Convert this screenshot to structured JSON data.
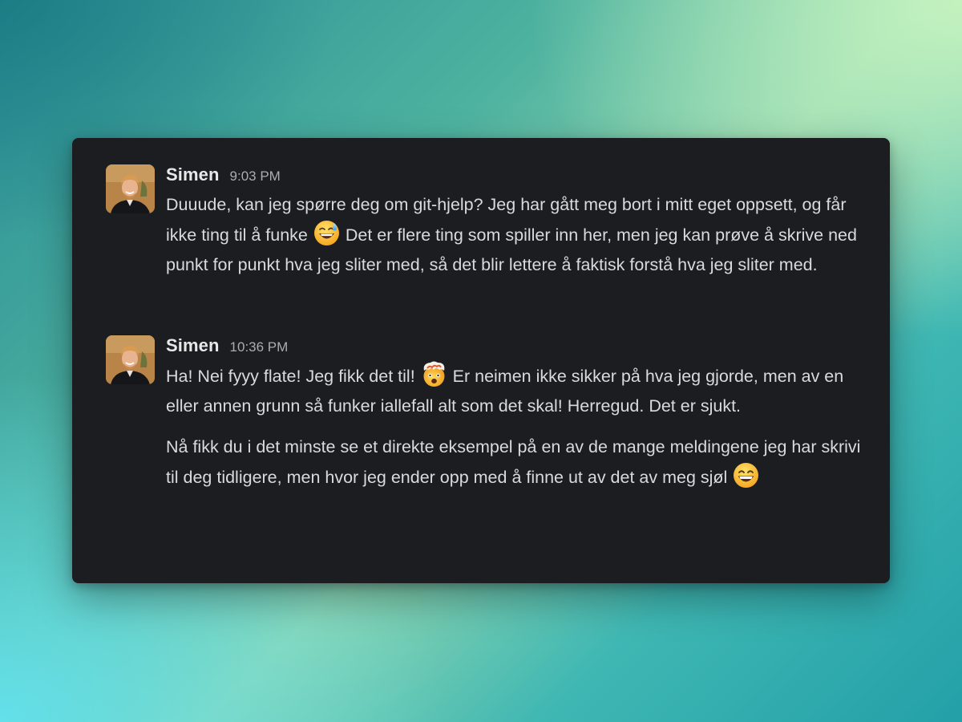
{
  "messages": [
    {
      "author": "Simen",
      "time": "9:03 PM",
      "paragraphs": [
        {
          "before": "Duuude, kan jeg spørre deg om git-hjelp? Jeg har gått meg bort i mitt eget oppsett, og får ikke ting til å funke",
          "emoji": "grinning-sweat-emoji",
          "after": "Det er flere ting som spiller inn her, men jeg kan prøve å skrive ned punkt for punkt hva jeg sliter med, så det blir lettere å faktisk forstå hva jeg sliter med."
        }
      ]
    },
    {
      "author": "Simen",
      "time": "10:36 PM",
      "paragraphs": [
        {
          "before": "Ha! Nei fyyy flate! Jeg fikk det til!",
          "emoji": "exploding-head-emoji",
          "after": "Er neimen ikke sikker på hva jeg gjorde, men av en eller annen grunn så funker iallefall alt som det skal! Herregud. Det er sjukt."
        },
        {
          "before": "Nå fikk du i det minste se et direkte eksempel på en av de mange meldingene jeg har skrivi til deg tidligere, men hvor jeg ender opp med å finne ut av det av meg sjøl",
          "emoji": "grinning-emoji",
          "after": ""
        }
      ]
    }
  ],
  "colors": {
    "card_background": "#1b1d21",
    "author": "#e8e8e8",
    "timestamp": "#a9acb1",
    "message_text": "#d9dadc"
  }
}
